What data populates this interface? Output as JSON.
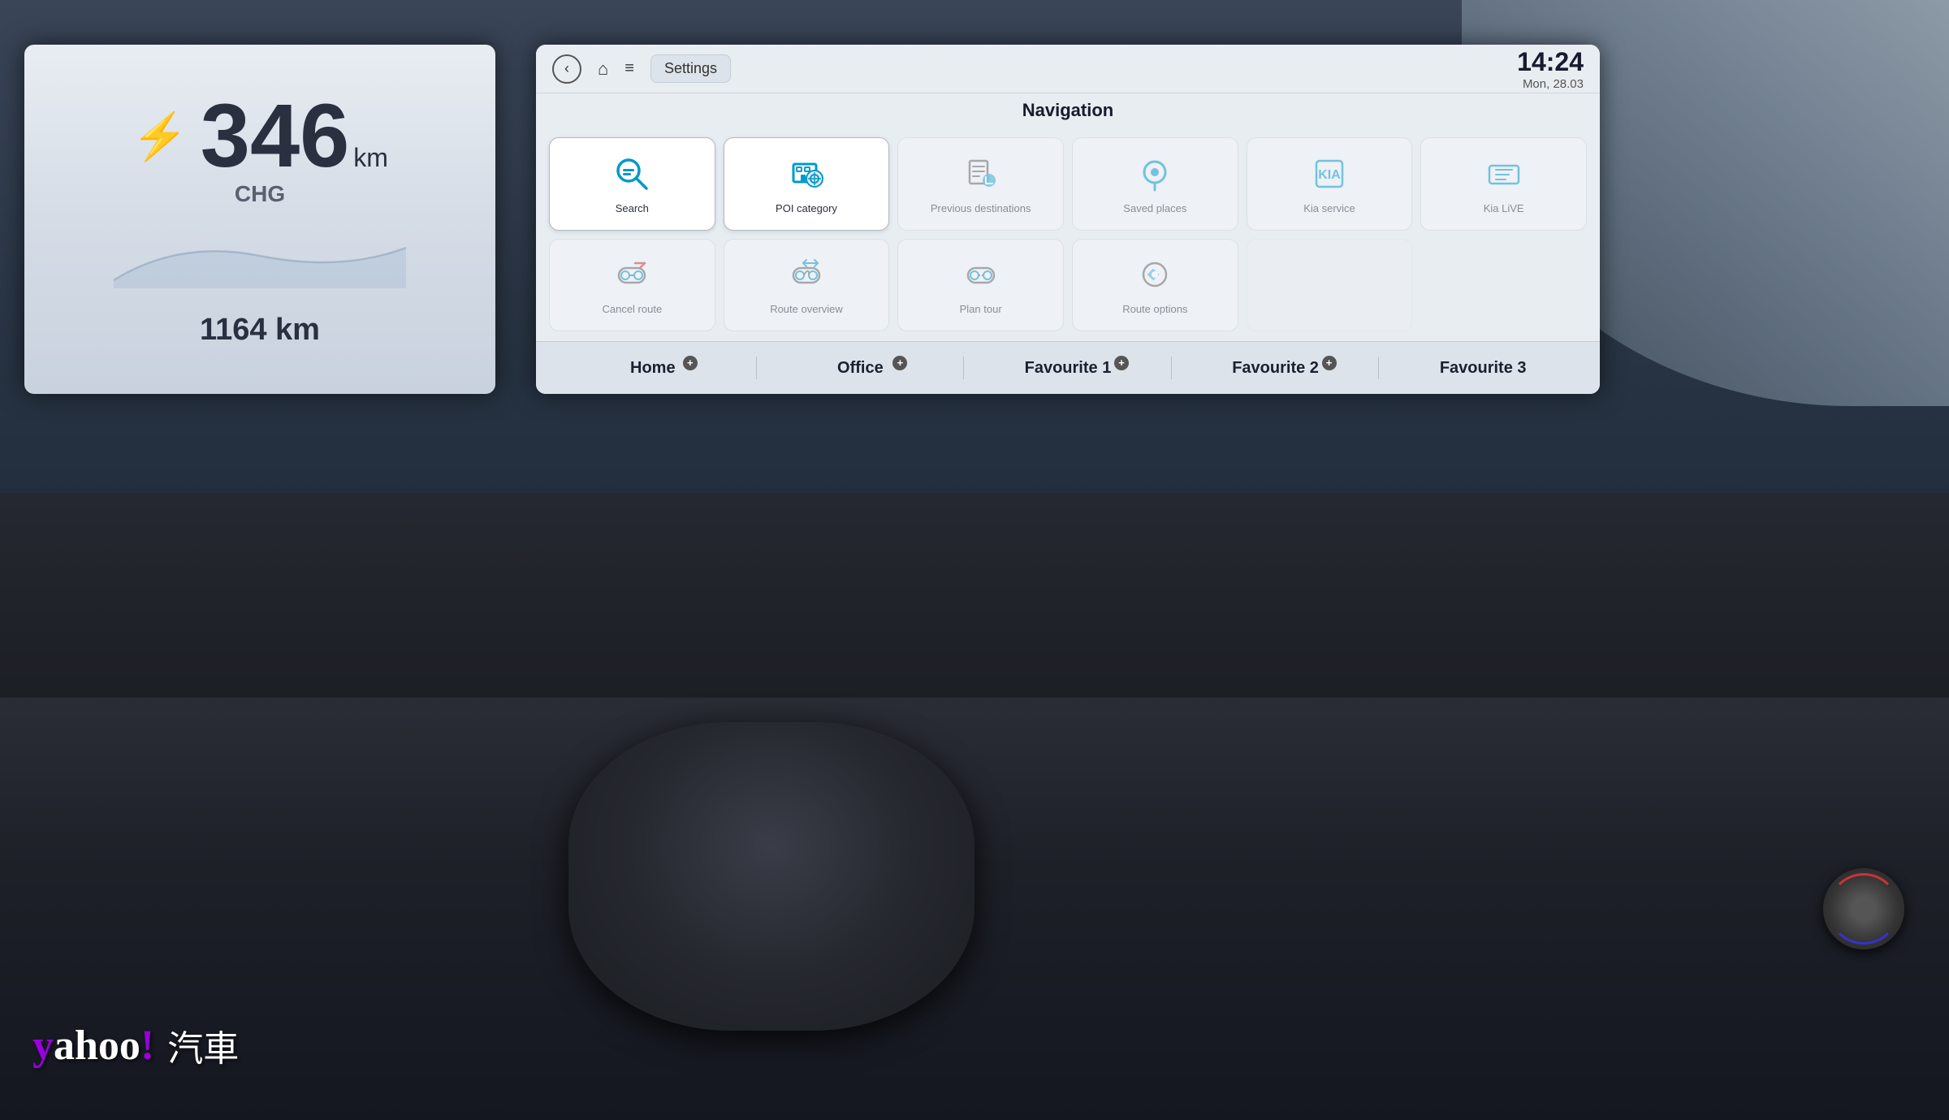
{
  "background": {
    "description": "Car interior with Kia EV dashboard and infotainment system"
  },
  "instrument_cluster": {
    "range_number": "346",
    "range_unit": "km",
    "label": "CHG",
    "total_range": "1164 km"
  },
  "infotainment": {
    "settings_label": "Settings",
    "back_icon": "‹",
    "home_icon": "⌂",
    "menu_icon": "≡",
    "time": "14:24",
    "date": "Mon, 28.03",
    "nav_title": "Navigation",
    "nav_items": [
      {
        "id": "search",
        "label": "Search",
        "icon": "search",
        "active": true
      },
      {
        "id": "poi",
        "label": "POI category",
        "icon": "poi",
        "active": true
      },
      {
        "id": "previous",
        "label": "Previous destinations",
        "icon": "previous",
        "active": false
      },
      {
        "id": "saved",
        "label": "Saved places",
        "icon": "saved",
        "active": false
      },
      {
        "id": "kia-service",
        "label": "Kia service",
        "icon": "kia-service",
        "active": false
      },
      {
        "id": "kia-live",
        "label": "Kia LiVE",
        "icon": "kia-live",
        "active": false
      },
      {
        "id": "cancel-route",
        "label": "Cancel route",
        "icon": "cancel-route",
        "active": false
      },
      {
        "id": "route-overview",
        "label": "Route overview",
        "icon": "route-overview",
        "active": false
      },
      {
        "id": "plan-tour",
        "label": "Plan tour",
        "icon": "plan-tour",
        "active": false
      },
      {
        "id": "route-options",
        "label": "Route options",
        "icon": "route-options",
        "active": false
      },
      {
        "id": "empty1",
        "label": "",
        "icon": "more",
        "active": false
      }
    ],
    "favorites": [
      {
        "id": "home",
        "label": "Home",
        "has_plus": true
      },
      {
        "id": "office",
        "label": "Office",
        "has_plus": true
      },
      {
        "id": "favourite1",
        "label": "Favourite 1",
        "has_plus": true
      },
      {
        "id": "favourite2",
        "label": "Favourite 2",
        "has_plus": true
      },
      {
        "id": "favourite3",
        "label": "Favourite 3",
        "has_plus": false
      }
    ]
  },
  "branding": {
    "yahoo": "yahoo!",
    "car_label": "汽車"
  }
}
